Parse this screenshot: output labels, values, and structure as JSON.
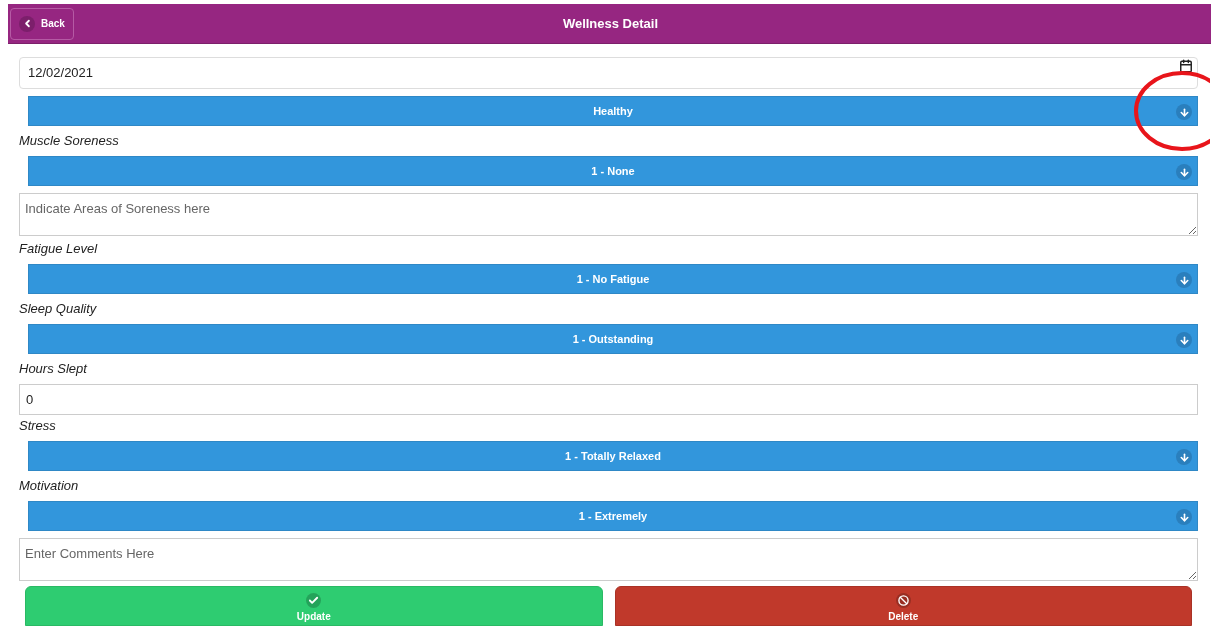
{
  "header": {
    "back": "Back",
    "title": "Wellness Detail"
  },
  "fields": [
    {
      "kind": "date",
      "value": "12/02/2021"
    },
    {
      "kind": "select",
      "value": "Healthy",
      "highlighted": true
    },
    {
      "kind": "label",
      "text": "Muscle Soreness"
    },
    {
      "kind": "select",
      "value": "1 - None",
      "highlighted": false
    },
    {
      "kind": "textarea",
      "placeholder": "Indicate Areas of Soreness here"
    },
    {
      "kind": "label",
      "text": "Fatigue Level"
    },
    {
      "kind": "select",
      "value": "1 - No Fatigue",
      "highlighted": false
    },
    {
      "kind": "label",
      "text": "Sleep Quality"
    },
    {
      "kind": "select",
      "value": "1 - Outstanding",
      "highlighted": false
    },
    {
      "kind": "label",
      "text": "Hours Slept"
    },
    {
      "kind": "number",
      "value": "0"
    },
    {
      "kind": "label",
      "text": "Stress"
    },
    {
      "kind": "select",
      "value": "1 - Totally Relaxed",
      "highlighted": false
    },
    {
      "kind": "label",
      "text": "Motivation"
    },
    {
      "kind": "select",
      "value": "1 - Extremely",
      "highlighted": false
    },
    {
      "kind": "textarea",
      "placeholder": "Enter Comments Here"
    }
  ],
  "actions": [
    {
      "kind": "update",
      "label": "Update"
    },
    {
      "kind": "delete",
      "label": "Delete"
    }
  ]
}
